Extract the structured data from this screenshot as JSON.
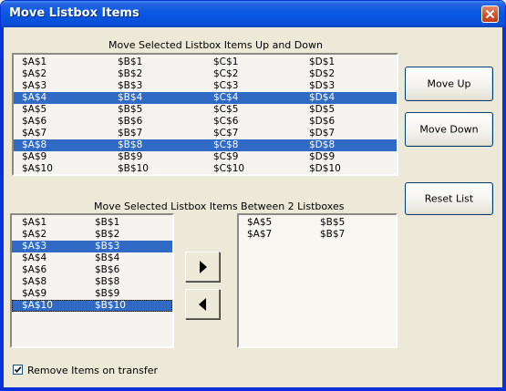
{
  "window": {
    "title": "Move Listbox Items",
    "close_icon": "close-icon"
  },
  "section_top": {
    "heading": "Move Selected Listbox Items Up and Down",
    "rows": [
      {
        "cells": [
          "$A$1",
          "$B$1",
          "$C$1",
          "$D$1"
        ],
        "selected": false
      },
      {
        "cells": [
          "$A$2",
          "$B$2",
          "$C$2",
          "$D$2"
        ],
        "selected": false
      },
      {
        "cells": [
          "$A$3",
          "$B$3",
          "$C$3",
          "$D$3"
        ],
        "selected": false
      },
      {
        "cells": [
          "$A$4",
          "$B$4",
          "$C$4",
          "$D$4"
        ],
        "selected": true
      },
      {
        "cells": [
          "$A$5",
          "$B$5",
          "$C$5",
          "$D$5"
        ],
        "selected": false
      },
      {
        "cells": [
          "$A$6",
          "$B$6",
          "$C$6",
          "$D$6"
        ],
        "selected": false
      },
      {
        "cells": [
          "$A$7",
          "$B$7",
          "$C$7",
          "$D$7"
        ],
        "selected": false
      },
      {
        "cells": [
          "$A$8",
          "$B$8",
          "$C$8",
          "$D$8"
        ],
        "selected": true
      },
      {
        "cells": [
          "$A$9",
          "$B$9",
          "$C$9",
          "$D$9"
        ],
        "selected": false
      },
      {
        "cells": [
          "$A$10",
          "$B$10",
          "$C$10",
          "$D$10"
        ],
        "selected": false
      }
    ]
  },
  "buttons": {
    "move_up": "Move Up",
    "move_down": "Move Down",
    "reset_list": "Reset List"
  },
  "section_bottom": {
    "heading": "Move Selected Listbox Items Between 2 Listboxes",
    "left_rows": [
      {
        "cells": [
          "$A$1",
          "$B$1"
        ],
        "selected": false,
        "focused": false
      },
      {
        "cells": [
          "$A$2",
          "$B$2"
        ],
        "selected": false,
        "focused": false
      },
      {
        "cells": [
          "$A$3",
          "$B$3"
        ],
        "selected": true,
        "focused": false
      },
      {
        "cells": [
          "$A$4",
          "$B$4"
        ],
        "selected": false,
        "focused": false
      },
      {
        "cells": [
          "$A$6",
          "$B$6"
        ],
        "selected": false,
        "focused": false
      },
      {
        "cells": [
          "$A$8",
          "$B$8"
        ],
        "selected": false,
        "focused": false
      },
      {
        "cells": [
          "$A$9",
          "$B$9"
        ],
        "selected": false,
        "focused": false
      },
      {
        "cells": [
          "$A$10",
          "$B$10"
        ],
        "selected": true,
        "focused": true
      }
    ],
    "right_rows": [
      {
        "cells": [
          "$A$5",
          "$B$5"
        ],
        "selected": false
      },
      {
        "cells": [
          "$A$7",
          "$B$7"
        ],
        "selected": false
      }
    ],
    "move_right_icon": "arrow-right-icon",
    "move_left_icon": "arrow-left-icon"
  },
  "checkbox": {
    "label": "Remove Items on transfer",
    "checked": true
  }
}
